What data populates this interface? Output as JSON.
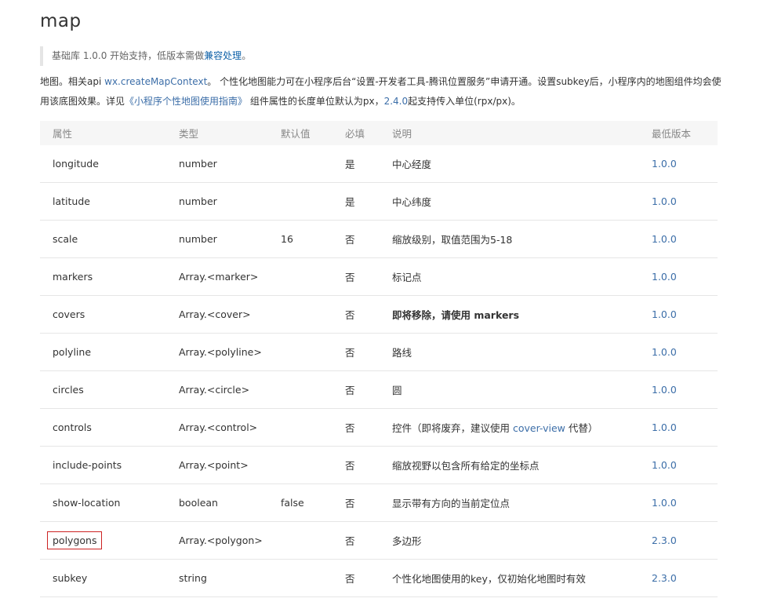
{
  "title": "map",
  "tip": {
    "prefix": "基础库 1.0.0 开始支持，低版本需做",
    "link": "兼容处理",
    "suffix": "。"
  },
  "description": {
    "p1": "地图。相关api ",
    "link_api": "wx.createMapContext",
    "p2": "。 个性化地图能力可在小程序后台“设置-开发者工具-腾讯位置服务”申请开通。设置subkey后，小程序内的地图组件均会使用该底图效果。详见",
    "link_guide": "《小程序个性地图使用指南》",
    "p3": " 组件属性的长度单位默认为px，",
    "link_version": "2.4.0",
    "p4": "起支持传入单位(rpx/px)。"
  },
  "table": {
    "headers": {
      "attr": "属性",
      "type": "类型",
      "default": "默认值",
      "required": "必填",
      "desc": "说明",
      "version": "最低版本"
    },
    "rows": [
      {
        "attr": "longitude",
        "type": "number",
        "default": "",
        "required": "是",
        "desc": "中心经度",
        "version": "1.0.0"
      },
      {
        "attr": "latitude",
        "type": "number",
        "default": "",
        "required": "是",
        "desc": "中心纬度",
        "version": "1.0.0"
      },
      {
        "attr": "scale",
        "type": "number",
        "default": "16",
        "required": "否",
        "desc": "缩放级别，取值范围为5-18",
        "version": "1.0.0"
      },
      {
        "attr": "markers",
        "type": "Array.<marker>",
        "default": "",
        "required": "否",
        "desc": "标记点",
        "version": "1.0.0"
      },
      {
        "attr": "covers",
        "type": "Array.<cover>",
        "default": "",
        "required": "否",
        "desc": "即将移除，请使用 markers",
        "version": "1.0.0"
      },
      {
        "attr": "polyline",
        "type": "Array.<polyline>",
        "default": "",
        "required": "否",
        "desc": "路线",
        "version": "1.0.0"
      },
      {
        "attr": "circles",
        "type": "Array.<circle>",
        "default": "",
        "required": "否",
        "desc": "圆",
        "version": "1.0.0"
      },
      {
        "attr": "controls",
        "type": "Array.<control>",
        "default": "",
        "required": "否",
        "desc_prefix": "控件（即将废弃，建议使用 ",
        "desc_link": "cover-view",
        "desc_suffix": " 代替）",
        "version": "1.0.0"
      },
      {
        "attr": "include-points",
        "type": "Array.<point>",
        "default": "",
        "required": "否",
        "desc": "缩放视野以包含所有给定的坐标点",
        "version": "1.0.0"
      },
      {
        "attr": "show-location",
        "type": "boolean",
        "default": "false",
        "required": "否",
        "desc": "显示带有方向的当前定位点",
        "version": "1.0.0"
      },
      {
        "attr": "polygons",
        "type": "Array.<polygon>",
        "default": "",
        "required": "否",
        "desc": "多边形",
        "version": "2.3.0"
      },
      {
        "attr": "subkey",
        "type": "string",
        "default": "",
        "required": "否",
        "desc": "个性化地图使用的key，仅初始化地图时有效",
        "version": "2.3.0"
      }
    ]
  }
}
